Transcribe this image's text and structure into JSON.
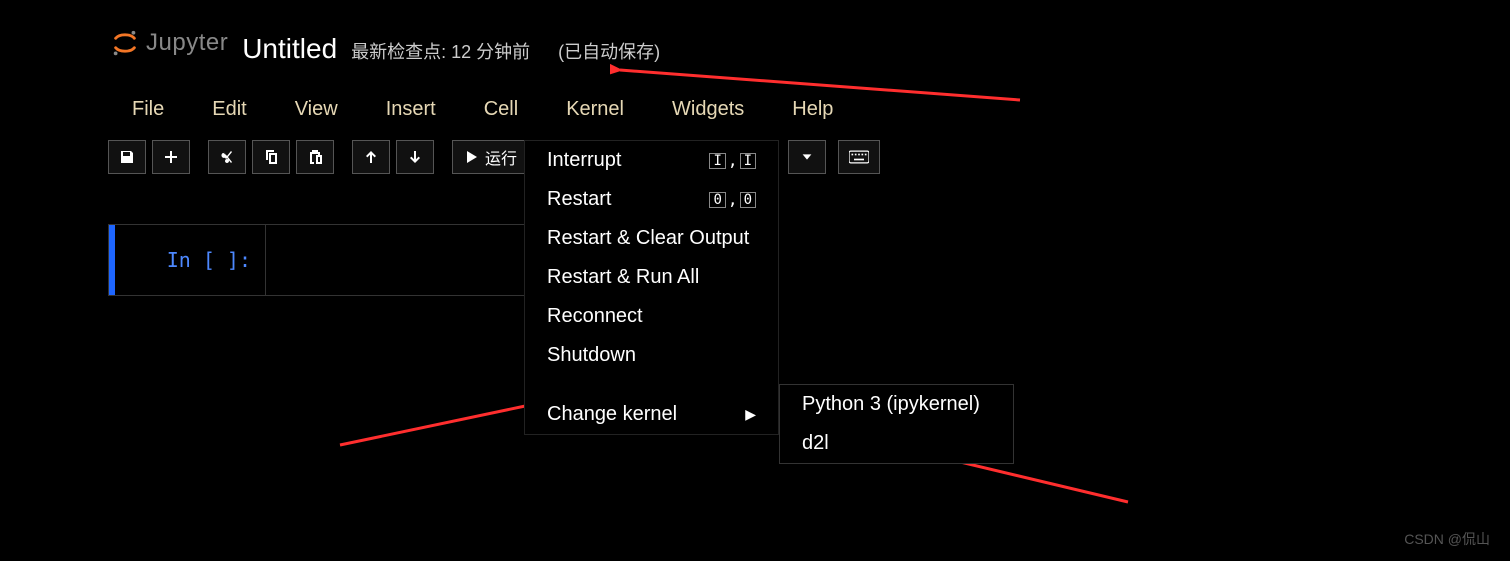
{
  "header": {
    "logo_text": "Jupyter",
    "title": "Untitled",
    "checkpoint": "最新检查点: 12 分钟前",
    "autosave": "(已自动保存)"
  },
  "menubar": [
    "File",
    "Edit",
    "View",
    "Insert",
    "Cell",
    "Kernel",
    "Widgets",
    "Help"
  ],
  "toolbar": {
    "run_label": "运行"
  },
  "kernel_menu": {
    "interrupt": "Interrupt",
    "interrupt_key": [
      "I",
      "I"
    ],
    "restart": "Restart",
    "restart_key": [
      "0",
      "0"
    ],
    "restart_clear": "Restart & Clear Output",
    "restart_runall": "Restart & Run All",
    "reconnect": "Reconnect",
    "shutdown": "Shutdown",
    "change_kernel": "Change kernel"
  },
  "kernel_submenu": {
    "items": [
      "Python 3 (ipykernel)",
      "d2l"
    ]
  },
  "cell": {
    "prompt": "In  [  ]:"
  },
  "watermark": "CSDN @侃山"
}
